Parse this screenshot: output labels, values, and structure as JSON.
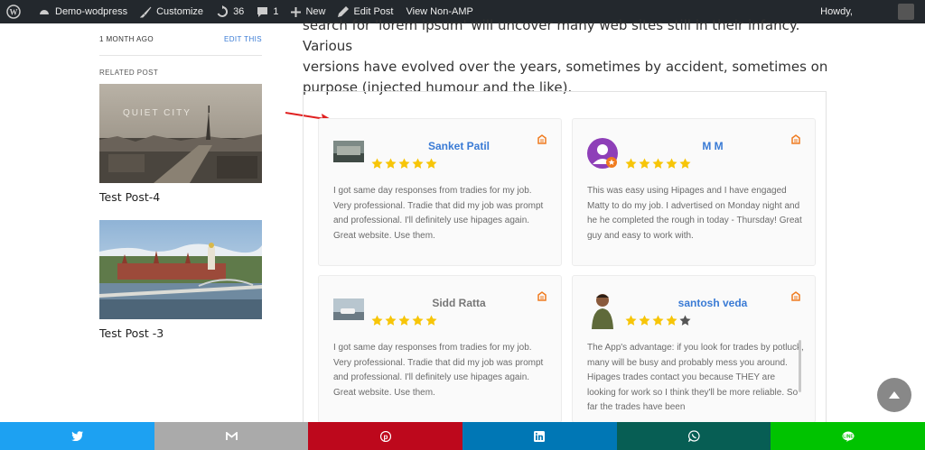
{
  "admin_bar": {
    "site_name": "Demo-wodpress",
    "customize": "Customize",
    "updates_count": "36",
    "comments_count": "1",
    "new": "New",
    "edit_post": "Edit Post",
    "view_non_amp": "View Non-AMP",
    "howdy": "Howdy,"
  },
  "sidebar": {
    "time_ago": "1 MONTH AGO",
    "edit_link": "EDIT THIS",
    "related_heading": "RELATED POST",
    "related_posts": [
      {
        "title": "Test Post-4",
        "image_caption": "QUIET CITY"
      },
      {
        "title": "Test Post -3"
      }
    ]
  },
  "article": {
    "intro_line1": "search for 'lorem ipsum' will uncover many web sites still in their infancy. Various",
    "intro_line2": "versions have evolved over the years, sometimes by accident, sometimes on",
    "intro_line3": "purpose (injected humour and the like)."
  },
  "reviews": [
    {
      "name": "Sanket Patil",
      "rating": 5,
      "text": "I got same day responses from tradies for my job. Very professional. Tradie that did my job was prompt and professional. I'll definitely use hipages again. Great website. Use them."
    },
    {
      "name": "M M",
      "rating": 5,
      "text": "This was easy using Hipages and I have engaged Matty to do my job. I advertised on Monday night and he he completed the rough in today - Thursday! Great guy and easy to work with."
    },
    {
      "name": "Sidd Ratta",
      "rating": 5,
      "text": "I got same day responses from tradies for my job. Very professional. Tradie that did my job was prompt and professional. I'll definitely use hipages again. Great website. Use them."
    },
    {
      "name": "santosh veda",
      "rating": 4,
      "text": "The App's advantage: if you look for trades by potluck, many will be busy and probably mess you around. Hipages trades contact you because THEY are looking for work so I think they'll be more reliable. So far the trades have been"
    }
  ],
  "share": [
    {
      "network": "twitter",
      "color": "#1da1f2"
    },
    {
      "network": "email",
      "color": "#aaaaaa"
    },
    {
      "network": "pinterest",
      "color": "#bd081c"
    },
    {
      "network": "linkedin",
      "color": "#0077b5"
    },
    {
      "network": "whatsapp",
      "color": "#075e54"
    },
    {
      "network": "line",
      "color": "#00c300"
    }
  ],
  "colors": {
    "star": "#f7c508",
    "star_empty": "#555555",
    "accent": "#3a7bd5",
    "source_icon": "#f07b1f"
  }
}
